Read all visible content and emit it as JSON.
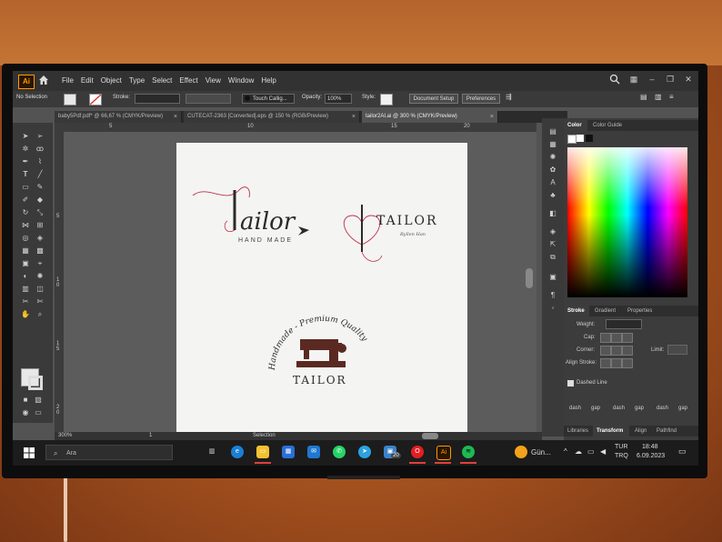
{
  "menubar": {
    "app_logo": "Ai",
    "items": [
      "File",
      "Edit",
      "Object",
      "Type",
      "Select",
      "Effect",
      "View",
      "Window",
      "Help"
    ]
  },
  "controlbar": {
    "selection": "No Selection",
    "stroke_label": "Stroke:",
    "brush": "Touch Callig...",
    "opacity_label": "Opacity:",
    "opacity_value": "100%",
    "style_label": "Style:",
    "document_setup": "Document Setup",
    "preferences": "Preferences"
  },
  "tabs": [
    {
      "label": "baby5Pdf.pdf* @ 66,67 % (CMYK/Preview)",
      "active": false
    },
    {
      "label": "CUTECAT-2363 [Converted].eps @ 150 % (RGB/Preview)",
      "active": false
    },
    {
      "label": "tailor2AI.ai @ 300 % (CMYK/Preview)",
      "active": true
    }
  ],
  "rulers": {
    "h_ticks": [
      "5",
      "10",
      "15",
      "20"
    ],
    "v_ticks": [
      "5",
      "1 0",
      "1 5",
      "2 0"
    ]
  },
  "artwork": {
    "logo1_word": "ailor",
    "logo1_tagline": "HAND MADE",
    "logo2_word": "TAILOR",
    "logo2_signature": "Byllen Han",
    "logo3_arc": "Handmade - Premium Quality",
    "logo3_word": "TAILOR"
  },
  "panels": {
    "color_tabs": [
      "Color",
      "Color Guide"
    ],
    "stroke_tabs": [
      "Stroke",
      "Gradient",
      "Properties"
    ],
    "weight_label": "Weight:",
    "cap_label": "Cap:",
    "corner_label": "Corner:",
    "limit_label": "Limit:",
    "align_label": "Align Stroke:",
    "dashed_line": "Dashed Line",
    "dash_labels": [
      "dash",
      "gap",
      "dash",
      "gap",
      "dash",
      "gap"
    ],
    "bottom_tabs": [
      "Libraries",
      "Transform",
      "Align",
      "Pathfind"
    ]
  },
  "statusbar": {
    "zoom": "300%",
    "page": "1",
    "tool": "Selection"
  },
  "taskbar": {
    "search_placeholder": "Ara",
    "weather": "Gün...",
    "lang_top": "TUR",
    "lang_bottom": "TRQ",
    "time": "18:48",
    "date": "6.09.2023",
    "badge": "20"
  },
  "colors": {
    "accent_ai": "#ff9a00",
    "logo_red": "#c0324a",
    "logo_dark": "#2a2a2a",
    "sewing_brown": "#5a2a22"
  }
}
